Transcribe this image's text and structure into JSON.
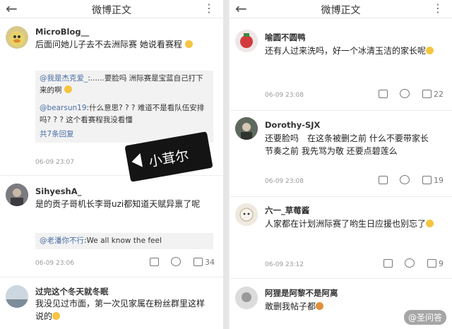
{
  "left": {
    "title": "微博正文",
    "comments": [
      {
        "user": "MicroBlog__",
        "text": "后面问她儿子去不去洲际赛 她说看赛程",
        "replies": [
          {
            "at": "@我是杰克爱_",
            "text": ":......要脸吗 洲际赛是宝蓝自己打下来的啊"
          },
          {
            "at": "@bearsun19",
            "text": ":什么意思? ? ? 难道不是看队伍安排吗? ? ? 这个看赛程我没看懂"
          }
        ],
        "more": "共7条回复",
        "time": "06-09 23:07"
      },
      {
        "user": "SihyeshA_",
        "text": "是的贡子哥机长李哥uzi都知道天赋异禀了呢",
        "reply": {
          "at": "@老潘你不行",
          "text": ":We all know the feel"
        },
        "time": "06-09 23:06",
        "likes": "34"
      },
      {
        "user": "过完这个冬天就冬眠",
        "text": "我没见过市面，第一次见家属在粉丝群里这样说的"
      }
    ],
    "sticker": "小茸尔"
  },
  "right": {
    "title": "微博正文",
    "comments": [
      {
        "user": "喻圆不圆鸭",
        "text": "还有人过来洗吗，好一个冰清玉洁的家长呢",
        "time": "06-09 23:08",
        "likes": "22"
      },
      {
        "user": "Dorothy-SJX",
        "text": "还要脸吗　在这条被删之前 什么不要带家长节奏之前 我先骂为敬 还要点碧莲么",
        "time": "06-09 23:08",
        "likes": "19"
      },
      {
        "user": "六一_草莓酱",
        "text": "人家都在计划洲际赛了哟生日应援也别忘了",
        "time": "06-09 23:12",
        "likes": "9"
      },
      {
        "user": "阿狸是阿黎不是阿离",
        "text": "敢删我帖子都"
      }
    ],
    "watermark": "@圣问答"
  },
  "icons": {
    "back": "←",
    "more": "⋮",
    "share": "share-icon",
    "comment": "comment-icon",
    "like": "like-icon"
  }
}
